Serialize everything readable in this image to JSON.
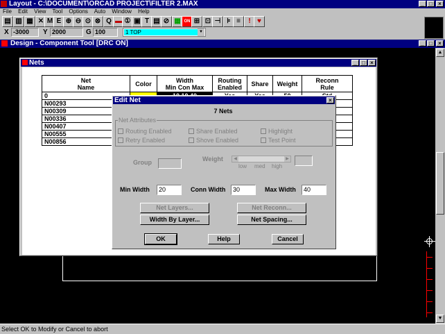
{
  "app": {
    "title": "Layout - C:\\DOCUMENT\\ORCAD PROJECT\\FILTER 2.MAX",
    "menu": [
      "File",
      "Edit",
      "View",
      "Tool",
      "Options",
      "Auto",
      "Window",
      "Help"
    ]
  },
  "coords": {
    "x_label": "X",
    "x_value": "-3000",
    "y_label": "Y",
    "y_value": "2000",
    "g_label": "G",
    "g_value": "100",
    "layer": "1  TOP"
  },
  "design_window": {
    "title": "Design - Component Tool [DRC ON]"
  },
  "nets_window": {
    "title": "Nets",
    "headers": {
      "net": "Net\nName",
      "color": "Color",
      "width": "Width\nMin Con Max",
      "routing": "Routing\nEnabled",
      "share": "Share",
      "weight": "Weight",
      "reconn": "Reconn\nRule"
    },
    "first_row": {
      "net": "0",
      "width": "10  10  40",
      "routing": "Yes",
      "share": "Yes",
      "weight": "50",
      "reconn": "Std"
    },
    "rows": [
      "N00293",
      "N00309",
      "N00336",
      "N00407",
      "N00555",
      "N00856"
    ]
  },
  "edit_net": {
    "title": "Edit Net",
    "heading": "7 Nets",
    "attributes_label": "Net Attributes",
    "routing_enabled": "Routing Enabled",
    "share_enabled": "Share Enabled",
    "highlight": "Highlight",
    "retry_enabled": "Retry Enabled",
    "shove_enabled": "Shove Enabled",
    "test_point": "Test Point",
    "group_label": "Group",
    "weight_label": "Weight",
    "weight_low": "low",
    "weight_med": "med",
    "weight_high": "high",
    "min_width_label": "Min Width",
    "min_width_value": "20",
    "conn_width_label": "Conn Width",
    "conn_width_value": "30",
    "max_width_label": "Max Width",
    "max_width_value": "40",
    "net_layers": "Net Layers...",
    "net_reconn": "Net Reconn...",
    "width_by_layer": "Width By Layer...",
    "net_spacing": "Net Spacing...",
    "ok": "OK",
    "help": "Help",
    "cancel": "Cancel"
  },
  "status": "Select OK to Modify or Cancel to abort"
}
